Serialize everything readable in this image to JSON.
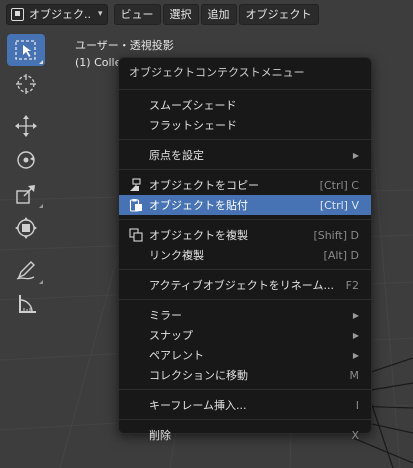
{
  "header": {
    "mode_label": "オブジェク..",
    "menus": [
      "ビュー",
      "選択",
      "追加",
      "オブジェクト"
    ]
  },
  "viewport": {
    "view_name": "ユーザー・透視投影",
    "collection_label": "(1) Colle"
  },
  "context_menu": {
    "title": "オブジェクトコンテクストメニュー",
    "groups": [
      [
        {
          "label": "スムーズシェード",
          "shortcut": "",
          "submenu": false,
          "icon": ""
        },
        {
          "label": "フラットシェード",
          "shortcut": "",
          "submenu": false,
          "icon": ""
        }
      ],
      [
        {
          "label": "原点を設定",
          "shortcut": "",
          "submenu": true,
          "icon": ""
        }
      ],
      [
        {
          "label": "オブジェクトをコピー",
          "shortcut": "[Ctrl] C",
          "submenu": false,
          "icon": "copy-icon"
        },
        {
          "label": "オブジェクトを貼付",
          "shortcut": "[Ctrl] V",
          "submenu": false,
          "icon": "paste-icon",
          "highlighted": true
        }
      ],
      [
        {
          "label": "オブジェクトを複製",
          "shortcut": "[Shift] D",
          "submenu": false,
          "icon": "duplicate-icon"
        },
        {
          "label": "リンク複製",
          "shortcut": "[Alt] D",
          "submenu": false,
          "icon": ""
        }
      ],
      [
        {
          "label": "アクティブオブジェクトをリネーム...",
          "shortcut": "F2",
          "submenu": false,
          "icon": ""
        }
      ],
      [
        {
          "label": "ミラー",
          "shortcut": "",
          "submenu": true,
          "icon": ""
        },
        {
          "label": "スナップ",
          "shortcut": "",
          "submenu": true,
          "icon": ""
        },
        {
          "label": "ペアレント",
          "shortcut": "",
          "submenu": true,
          "icon": ""
        },
        {
          "label": "コレクションに移動",
          "shortcut": "M",
          "submenu": false,
          "icon": ""
        }
      ],
      [
        {
          "label": "キーフレーム挿入...",
          "shortcut": "I",
          "submenu": false,
          "icon": ""
        }
      ],
      [
        {
          "label": "削除",
          "shortcut": "X",
          "submenu": false,
          "icon": ""
        }
      ]
    ]
  },
  "colors": {
    "accent": "#4772b3",
    "menu_bg": "#181818",
    "viewport_bg": "#3d3d3d"
  }
}
